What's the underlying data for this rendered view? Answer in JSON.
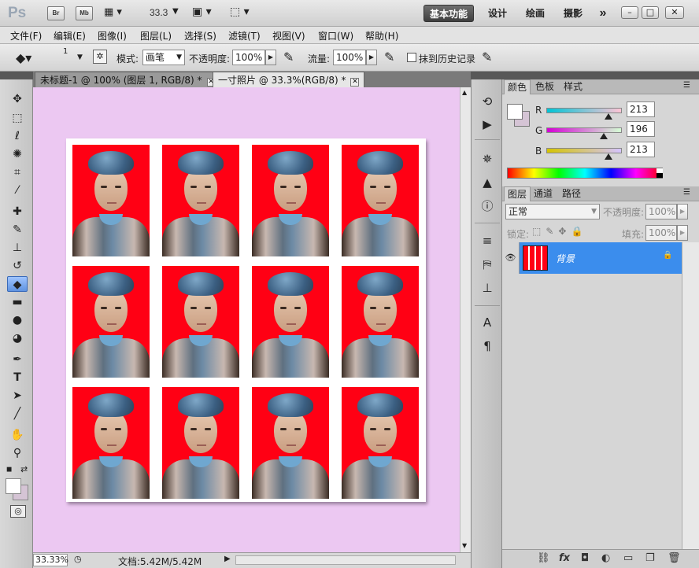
{
  "titlebar": {
    "app_logo": "Ps",
    "br_label": "Br",
    "mb_label": "Mb",
    "zoom_value": "33.3",
    "workspaces": [
      "基本功能",
      "设计",
      "绘画",
      "摄影"
    ],
    "overflow": "»",
    "win_min": "–",
    "win_restore": "□",
    "win_close": "✕"
  },
  "menu": [
    "文件(F)",
    "编辑(E)",
    "图像(I)",
    "图层(L)",
    "选择(S)",
    "滤镜(T)",
    "视图(V)",
    "窗口(W)",
    "帮助(H)"
  ],
  "options": {
    "brush_size": "1",
    "mode_label": "模式:",
    "mode_value": "画笔",
    "opacity_label": "不透明度:",
    "opacity_value": "100%",
    "flow_label": "流量:",
    "flow_value": "100%",
    "erase_history_label": "抹到历史记录"
  },
  "documents": [
    {
      "title": "未标题-1 @ 100% (图层 1, RGB/8) *",
      "close": "✕"
    },
    {
      "title": "一寸照片 @ 33.3%(RGB/8) *",
      "close": "✕"
    }
  ],
  "status": {
    "zoom": "33.33%",
    "doc_info": "文档:5.42M/5.42M"
  },
  "color_panel": {
    "tabs": [
      "颜色",
      "色板",
      "样式"
    ],
    "channels": [
      {
        "name": "R",
        "value": "213",
        "level": 0.835
      },
      {
        "name": "G",
        "value": "196",
        "level": 0.769
      },
      {
        "name": "B",
        "value": "213",
        "level": 0.835
      }
    ],
    "foreground": "#ffffff",
    "background": "#d5c4d5"
  },
  "layers_panel": {
    "tabs": [
      "图层",
      "通道",
      "路径"
    ],
    "blend_mode": "正常",
    "opacity_label": "不透明度:",
    "opacity_value": "100%",
    "lock_label": "锁定:",
    "fill_label": "填充:",
    "fill_value": "100%",
    "layers": [
      {
        "name": "背景",
        "visible": true,
        "locked": true
      }
    ]
  },
  "colors": {
    "canvas_bg": "#ecc8f2",
    "photo_bg": "#ff0014",
    "selected_layer": "#3b8ded"
  }
}
